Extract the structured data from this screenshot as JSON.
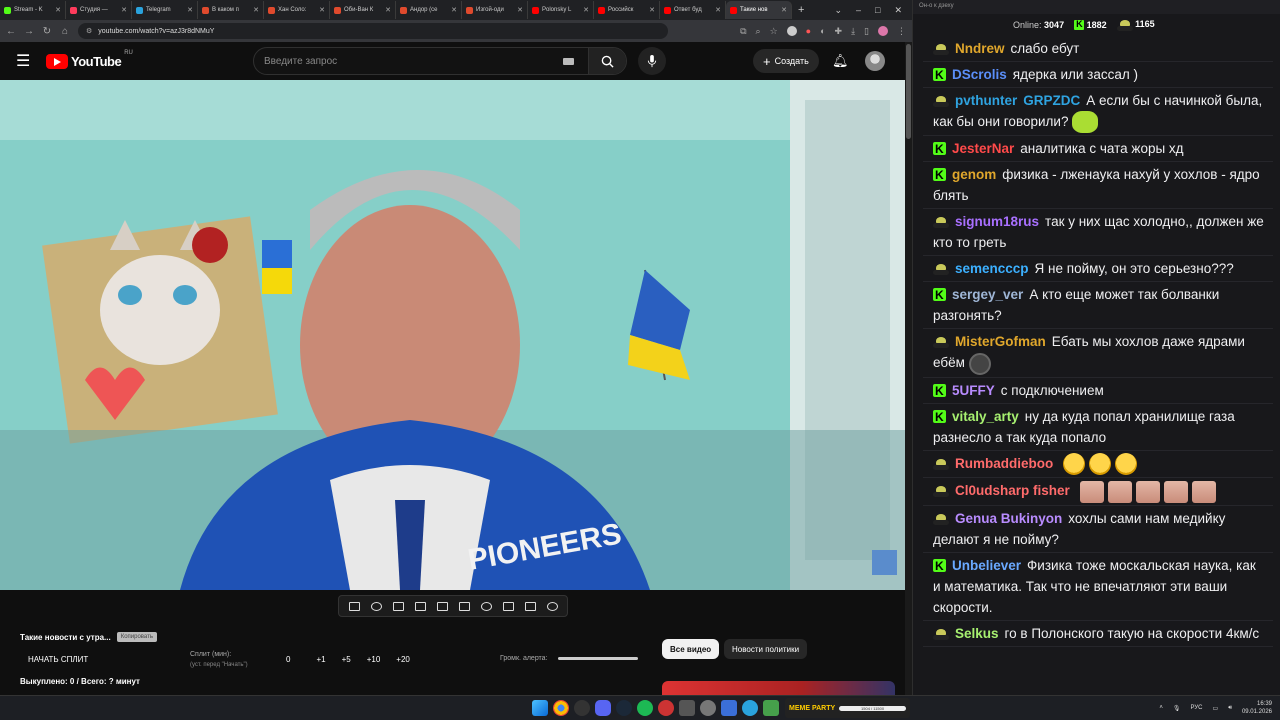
{
  "browser": {
    "tabs": [
      {
        "title": "Stream - K",
        "color": "#53fc18"
      },
      {
        "title": "Студия —",
        "color": "#ff3b5c"
      },
      {
        "title": "Telegram",
        "color": "#2aa3dd"
      },
      {
        "title": "В каком п",
        "color": "#e04a2d"
      },
      {
        "title": "Хан Соло:",
        "color": "#e04a2d"
      },
      {
        "title": "Оби-Ван К",
        "color": "#e04a2d"
      },
      {
        "title": "Андор (се",
        "color": "#e04a2d"
      },
      {
        "title": "Изгой-оди",
        "color": "#e04a2d"
      },
      {
        "title": "Polonsky L",
        "color": "#ff0000"
      },
      {
        "title": "Российск",
        "color": "#ff0000"
      },
      {
        "title": "Ответ буд",
        "color": "#ff0000"
      },
      {
        "title": "Такие нов",
        "color": "#ff0000",
        "active": true
      }
    ],
    "url": "youtube.com/watch?v=azJ3r8dNMuY"
  },
  "youtube": {
    "logo_text": "YouTube",
    "country_code": "RU",
    "search_placeholder": "Введите запрос",
    "create_label": "Создать"
  },
  "below_player": {
    "title": "Такие новости с утра...",
    "chip": "Копировать",
    "split_button": "НАЧАТЬ СПЛИТ",
    "split_label": "Сплит (мин):",
    "split_hint": "(уст. перед \"Начать\")",
    "split_value": "0",
    "steps": [
      "+1",
      "+5",
      "+10",
      "+20"
    ],
    "volume_label": "Громк. алерта:",
    "bought": "Выкуплено: 0 / Всего: ? минут",
    "chip_all": "Все видео",
    "chip_politics": "Новости политики"
  },
  "taskbar": {
    "lang": "РУС",
    "time": "16:39",
    "date": "09.01.2026",
    "meme_label": "MEME PARTY",
    "meme_progress": "1504 / 11500"
  },
  "chat": {
    "window_title": "Он-о к дзеху",
    "online_label": "Online:",
    "online_count": "3047",
    "kick_count": "1882",
    "yt_count": "1165",
    "messages": [
      {
        "user": "Nndrew",
        "color": "#e0a72c",
        "badge": "pepe",
        "text": "слабо ебут"
      },
      {
        "user": "DScrolis",
        "color": "#5b8ff9",
        "badge": "kick",
        "text": "ядерка или зассал )"
      },
      {
        "user": "pvthunter",
        "user2": "GRPZDC",
        "color": "#2fa3e0",
        "badge": "pepe",
        "text": "А если бы с начинкой была, как бы они говорили?",
        "emote": "peph"
      },
      {
        "user": "JesterNar",
        "color": "#ff4a4a",
        "badge": "kick",
        "text": "аналитика с чата жоры хд"
      },
      {
        "user": "genom",
        "color": "#e0a72c",
        "badge": "kick",
        "text": "физика - лженаука нахуй у хохлов - ядро блять"
      },
      {
        "user": "signum18rus",
        "color": "#a970ff",
        "badge": "pepe",
        "text": "так у них щас холодно,, должен же кто то греть"
      },
      {
        "user": "semencccp",
        "color": "#3cb0ff",
        "badge": "pepe",
        "text": "Я не пойму, он это серьезно???"
      },
      {
        "user": "sergey_ver",
        "color": "#9fb6d6",
        "badge": "kick",
        "text": "А кто еще может так болванки разгонять?"
      },
      {
        "user": "MisterGofman",
        "color": "#e0a72c",
        "badge": "pepe",
        "text": "Ебать мы хохлов даже ядрами ебём",
        "emote": "dark"
      },
      {
        "user": "5UFFY",
        "color": "#b98cff",
        "badge": "kick",
        "text": "с подключением"
      },
      {
        "user": "vitaly_arty",
        "color": "#a7f070",
        "badge": "kick",
        "text": "ну да куда попал хранилище газа разнесло а так куда попало"
      },
      {
        "user": "Rumbaddieboo",
        "color": "#ff6b6b",
        "badge": "pepe",
        "text": "",
        "emotes": [
          "laugh",
          "laugh",
          "laugh"
        ]
      },
      {
        "user": "Cl0udsharp fisher",
        "color": "#ff6b6b",
        "badge": "pepe",
        "text": "",
        "emotes": [
          "face",
          "face",
          "face",
          "face",
          "face"
        ]
      },
      {
        "user": "Genua Bukinyon",
        "color": "#b98cff",
        "badge": "pepe",
        "text": "хохлы сами нам медийку делают я не пойму?"
      },
      {
        "user": "Unbeliever",
        "color": "#6aa9ff",
        "badge": "kick",
        "text": "Физика тоже москальская наука, как и математика. Так что не впечатляют эти ваши скорости."
      },
      {
        "user": "Selkus",
        "color": "#a7f070",
        "badge": "pepe",
        "text": "го в Полонского такую на скорости 4км/с"
      }
    ]
  }
}
